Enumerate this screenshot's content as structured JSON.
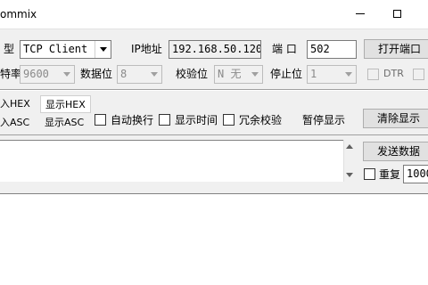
{
  "window": {
    "title": "ommix",
    "title_full": "Commix"
  },
  "conn": {
    "type_label": "型",
    "type_value": "TCP Client",
    "ip_label": "IP地址",
    "ip_value": "192.168.50.120",
    "port_label": "端 口",
    "port_value": "502",
    "open_button": "打开端口"
  },
  "serial": {
    "baud_label": "特率",
    "baud_value": "9600",
    "databits_label": "数据位",
    "databits_value": "8",
    "parity_label": "校验位",
    "parity_value": "N 无",
    "stopbits_label": "停止位",
    "stopbits_value": "1",
    "dtr_label": "DTR"
  },
  "display": {
    "input_hex": "入HEX",
    "show_hex_tab": "显示HEX",
    "input_asc": "入ASC",
    "show_asc": "显示ASC",
    "auto_wrap": "自动换行",
    "show_time": "显示时间",
    "redundant_check": "冗余校验",
    "pause_display": "暂停显示",
    "clear_display_button": "清除显示"
  },
  "send": {
    "send_data_button": "发送数据",
    "repeat_label": "重复",
    "repeat_value": "1000"
  },
  "colors": {
    "window_bg": "#f0f0f0",
    "titlebar_bg": "#ffffff",
    "text": "#000000",
    "disabled_text": "#6d6d6d"
  }
}
